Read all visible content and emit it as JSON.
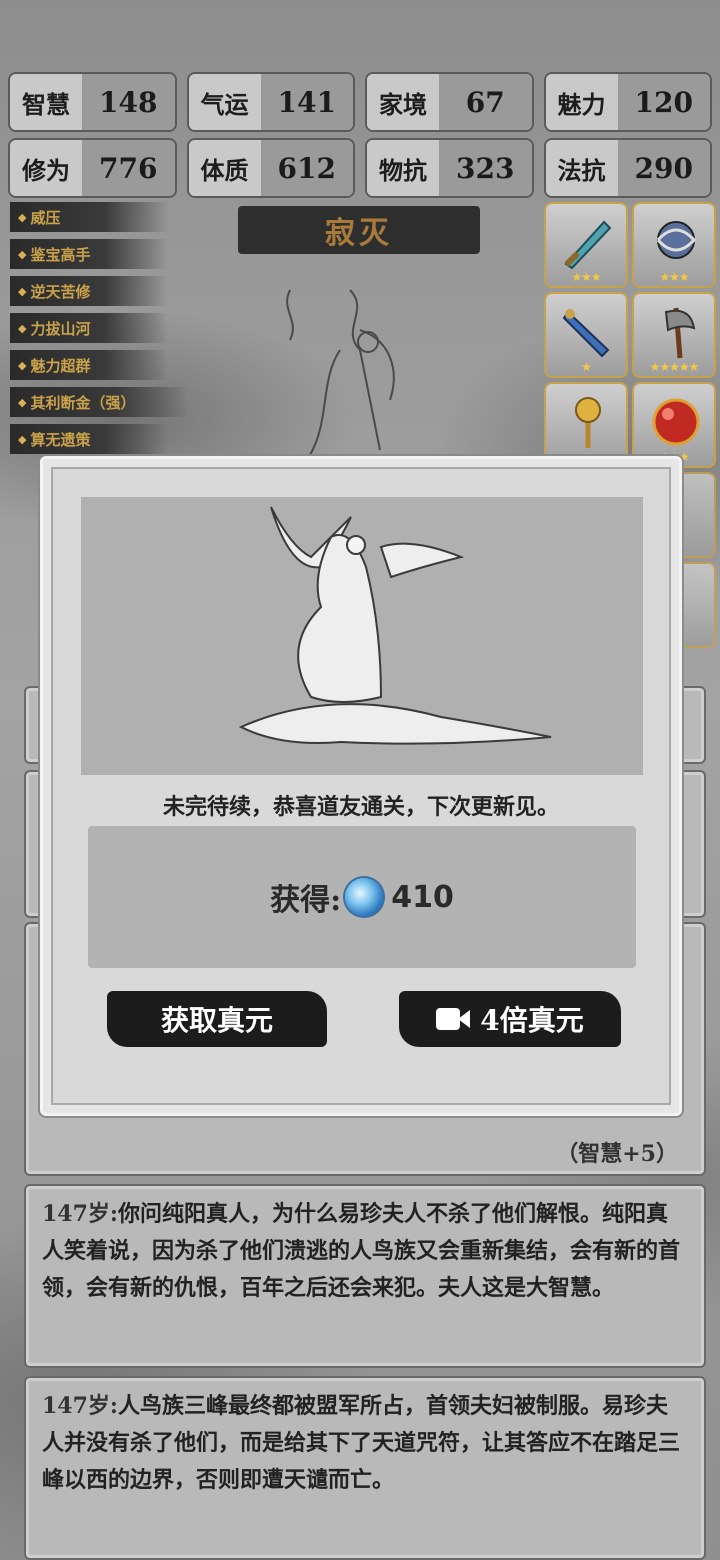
{
  "stats": [
    {
      "label": "智慧",
      "value": "148"
    },
    {
      "label": "气运",
      "value": "141"
    },
    {
      "label": "家境",
      "value": "67"
    },
    {
      "label": "魅力",
      "value": "120"
    },
    {
      "label": "修为",
      "value": "776"
    },
    {
      "label": "体质",
      "value": "612"
    },
    {
      "label": "物抗",
      "value": "323"
    },
    {
      "label": "法抗",
      "value": "290"
    }
  ],
  "traits": [
    "威压",
    "鉴宝高手",
    "逆天苦修",
    "力拔山河",
    "魅力超群",
    "其利断金（强）",
    "算无遗策"
  ],
  "title_banner": "寂灭",
  "equipment": [
    {
      "icon": "sword-icon",
      "stars": "★★★"
    },
    {
      "icon": "dragon-orb-icon",
      "stars": "★★★"
    },
    {
      "icon": "dagger-icon",
      "stars": "★"
    },
    {
      "icon": "axe-icon",
      "stars": "★★★★★"
    },
    {
      "icon": "golden-staff-icon",
      "stars": "★"
    },
    {
      "icon": "red-orb-icon",
      "stars": "★★★"
    }
  ],
  "story": [
    {
      "age": "147岁:",
      "text": "你问纯阳真人，为什么易珍夫人不杀了他们解恨。纯阳真人笑着说，因为杀了他们溃逃的人鸟族又会重新集结，会有新的首领，会有新的仇恨，百年之后还会来犯。夫人这是大智慧。"
    },
    {
      "age": "147岁:",
      "text": "人鸟族三峰最终都被盟军所占，首领夫妇被制服。易珍夫人并没有杀了他们，而是给其下了天道咒符，让其答应不在踏足三峰以西的边界，否则即遭天谴而亡。"
    }
  ],
  "partial_bonus": "（智慧+5）",
  "modal": {
    "message": "未完待续，恭喜道友通关，下次更新见。",
    "reward_label": "获得:",
    "reward_icon": "spirit-gem-icon",
    "reward_value": "410",
    "claim_button": "获取真元",
    "video_button": "4倍真元",
    "video_icon": "video-camera-icon"
  },
  "colors": {
    "trait_text": "#c9a24a",
    "frame_gold": "#c6a24b",
    "title_text": "#a97b3b"
  }
}
